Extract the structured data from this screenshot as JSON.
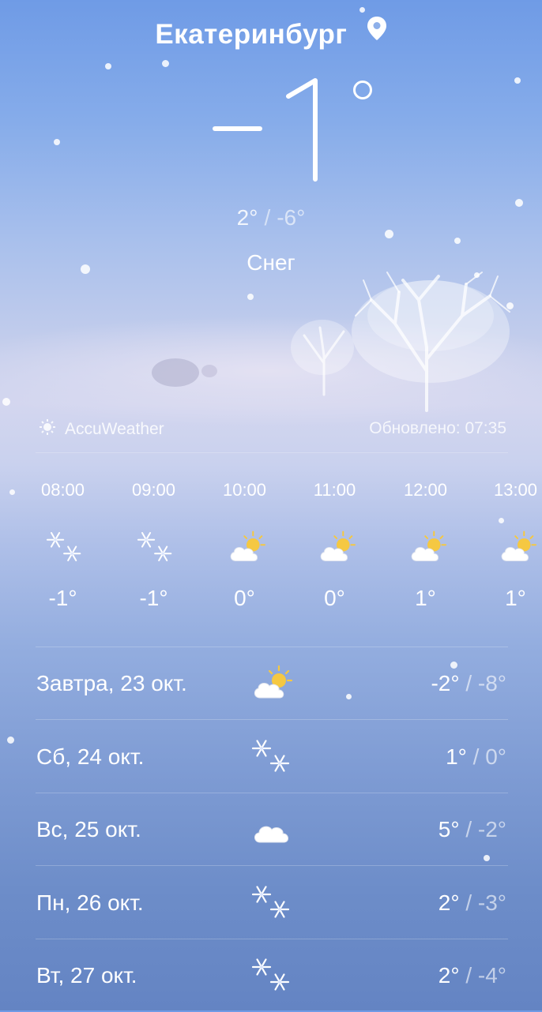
{
  "header": {
    "city": "Екатеринбург",
    "current_temp": "−1",
    "high": "2°",
    "separator": "/",
    "low": "-6°",
    "condition": "Снег"
  },
  "meta": {
    "provider": "AccuWeather",
    "updated": "Обновлено: 07:35"
  },
  "hourly": [
    {
      "time": "08:00",
      "icon": "snow-icon",
      "temp": "-1°"
    },
    {
      "time": "09:00",
      "icon": "snow-icon",
      "temp": "-1°"
    },
    {
      "time": "10:00",
      "icon": "partly-cloudy-icon",
      "temp": "0°"
    },
    {
      "time": "11:00",
      "icon": "partly-cloudy-icon",
      "temp": "0°"
    },
    {
      "time": "12:00",
      "icon": "partly-cloudy-icon",
      "temp": "1°"
    },
    {
      "time": "13:00",
      "icon": "partly-cloudy-icon",
      "temp": "1°"
    }
  ],
  "daily": [
    {
      "label": "Завтра, 23 окт.",
      "icon": "partly-cloudy-icon",
      "high": "-2°",
      "sep": "/",
      "low": "-8°"
    },
    {
      "label": "Сб, 24 окт.",
      "icon": "snow-icon",
      "high": "1°",
      "sep": "/",
      "low": "0°"
    },
    {
      "label": "Вс, 25 окт.",
      "icon": "cloud-icon",
      "high": "5°",
      "sep": "/",
      "low": "-2°"
    },
    {
      "label": "Пн, 26 окт.",
      "icon": "snow-icon",
      "high": "2°",
      "sep": "/",
      "low": "-3°"
    },
    {
      "label": "Вт, 27 окт.",
      "icon": "snow-icon",
      "high": "2°",
      "sep": "/",
      "low": "-4°"
    }
  ],
  "colors": {
    "sky_top": "#6f9be6",
    "fog": "#d3d6ef",
    "bottom": "#6484c3",
    "sun": "#f5c842"
  }
}
